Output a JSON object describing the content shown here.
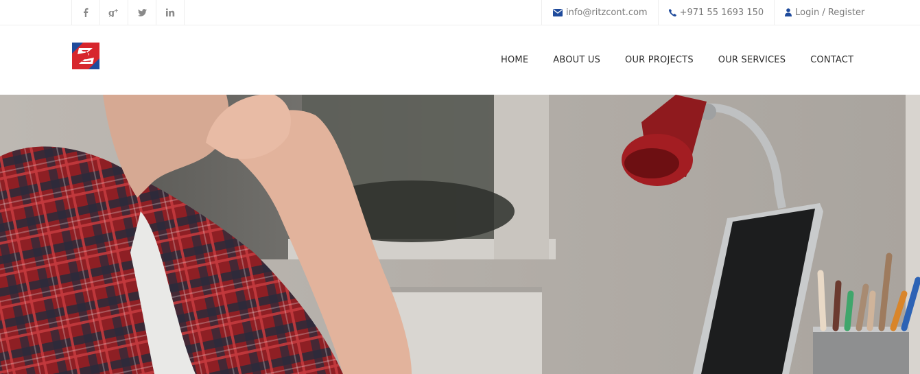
{
  "topbar": {
    "social": [
      {
        "name": "facebook-icon"
      },
      {
        "name": "google-plus-icon"
      },
      {
        "name": "twitter-icon"
      },
      {
        "name": "linkedin-icon"
      }
    ],
    "email": "info@ritzcont.com",
    "phone": "+971 55 1693 150",
    "account": "Login / Register"
  },
  "nav": {
    "items": [
      "HOME",
      "ABOUT US",
      "OUR PROJECTS",
      "OUR SERVICES",
      "CONTACT"
    ]
  },
  "colors": {
    "brand_blue": "#1f4b9c",
    "brand_red": "#d7262d",
    "icon_blue": "#1f4b9c"
  }
}
